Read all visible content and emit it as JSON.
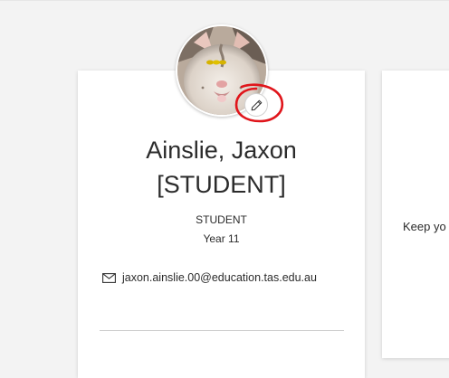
{
  "profile": {
    "name": "Ainslie, Jaxon",
    "name_tag": "[STUDENT]",
    "role": "STUDENT",
    "year": "Year 11",
    "email": "jaxon.ainslie.00@education.tas.edu.au",
    "avatar_description": "profile photo (cat)",
    "edit_button": {
      "icon": "pencil-icon"
    }
  },
  "side_card": {
    "partial_text": "Keep yo"
  },
  "colors": {
    "background": "#f3f3f3",
    "card": "#ffffff",
    "text": "#2b2b2b",
    "annotation": "#e0151b"
  }
}
